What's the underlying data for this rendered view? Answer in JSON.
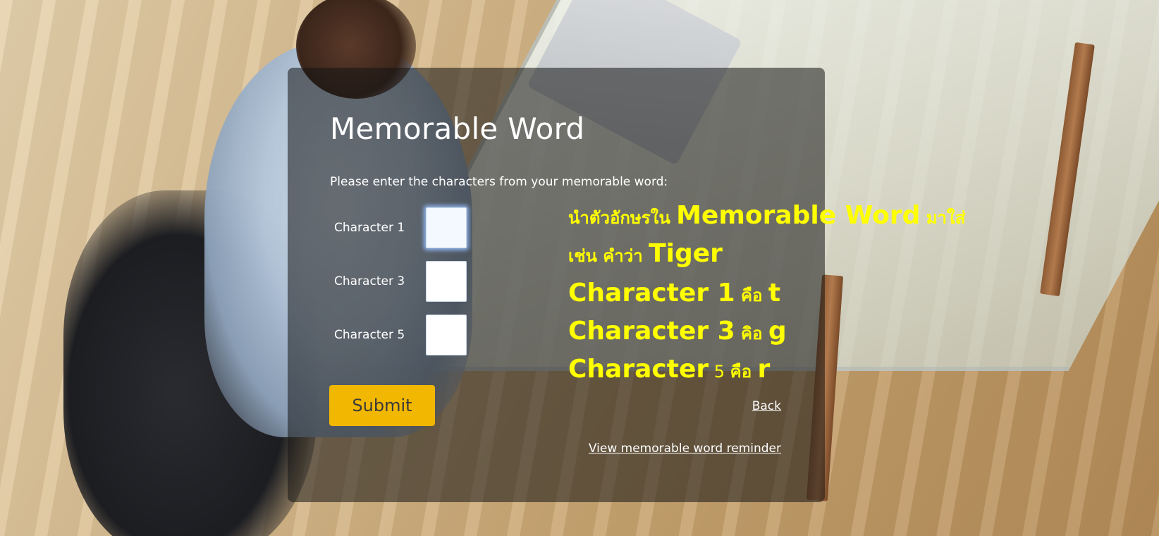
{
  "form": {
    "title": "Memorable Word",
    "instruction": "Please enter the characters from your memorable word:",
    "fields": [
      {
        "label": "Character 1",
        "value": "",
        "focused": true
      },
      {
        "label": "Character 3",
        "value": ""
      },
      {
        "label": "Character 5",
        "value": ""
      }
    ],
    "submit_label": "Submit",
    "back_label": "Back",
    "reminder_label": "View memorable word reminder"
  },
  "annotation": {
    "line1_prefix": "นำตัวอักษรใน ",
    "line1_emph": "Memorable Word",
    "line1_suffix": " มาใส่",
    "line2_prefix": "เช่น คำว่า ",
    "line2_emph": "Tiger",
    "line3_emph": "Character 1",
    "line3_mid": " คือ ",
    "line3_val": "t",
    "line4_emph": "Character 3",
    "line4_mid": " คิอ ",
    "line4_val": "g",
    "line5_emph": "Character",
    "line5_num": " 5 ",
    "line5_mid": " คือ ",
    "line5_val": "r"
  },
  "colors": {
    "accent_button": "#f2b700",
    "annotation": "#ffff00",
    "panel_overlay": "rgba(20,20,20,0.55)"
  }
}
